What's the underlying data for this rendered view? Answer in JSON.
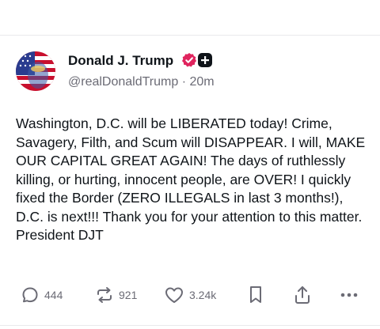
{
  "post": {
    "author": {
      "display_name": "Donald J. Trump",
      "handle": "@realDonaldTrump",
      "separator": "·",
      "time_ago": "20m"
    },
    "body": "Washington, D.C. will be LIBERATED today! Crime, Savagery, Filth, and Scum will DISAPPEAR. I will, MAKE OUR CAPITAL GREAT AGAIN! The days of ruthlessly killing, or hurting, innocent people, are OVER! I quickly fixed the Border (ZERO ILLEGALS in last 3 months!), D.C. is next!!! Thank you for your attention to this matter. President DJT",
    "actions": {
      "replies": "444",
      "reposts": "921",
      "likes": "3.24k"
    }
  },
  "icons": {
    "reply": "speech-bubble-icon",
    "repost": "repost-arrows-icon",
    "like": "heart-icon",
    "bookmark": "bookmark-icon",
    "share": "share-upload-icon",
    "more": "more-dots-icon",
    "verified": "verified-badge-icon",
    "plus": "plus-badge-icon"
  },
  "colors": {
    "verified": "#e0245e",
    "text": "#0f1419",
    "muted": "#6b6b75",
    "divider": "#e9e9ec"
  }
}
